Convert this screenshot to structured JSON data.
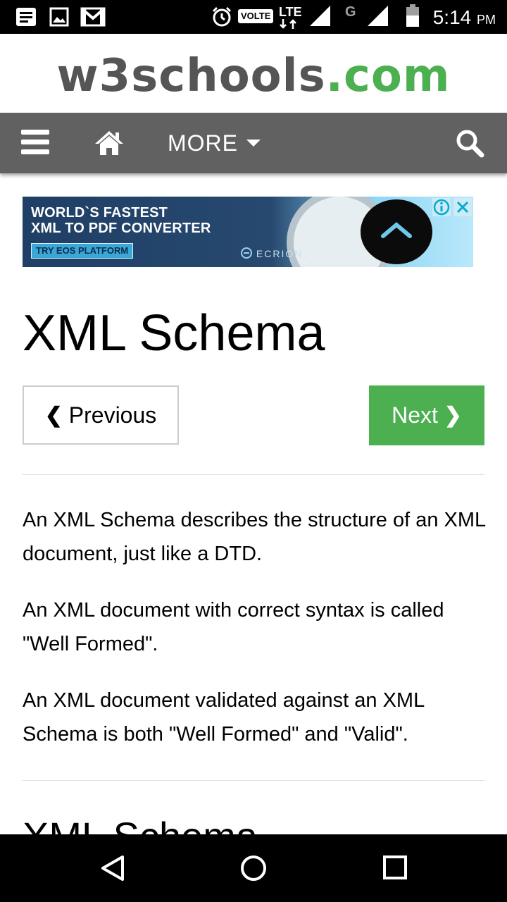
{
  "status_bar": {
    "left_icons": [
      "notification-icon",
      "gallery-icon",
      "gmail-icon"
    ],
    "right_icons": [
      "alarm-icon",
      "signal-icon",
      "signal-icon-2",
      "battery-icon"
    ],
    "volte": "VOLTE",
    "lte": "LTE",
    "network_g": "G",
    "time": "5:14",
    "ampm": "PM"
  },
  "header": {
    "logo_main": "w3schools",
    "logo_tld": ".com",
    "colors": {
      "logo_gray": "#555555",
      "logo_green": "#4CAF50"
    }
  },
  "nav": {
    "menu_icon": "hamburger-icon",
    "home_icon": "home-icon",
    "more_label": "MORE",
    "search_icon": "search-icon",
    "background": "#616161"
  },
  "ad": {
    "line1": "WORLD`S FASTEST",
    "line2": "XML TO PDF CONVERTER",
    "cta": "TRY EOS PLATFORM",
    "brand": "ECRION.",
    "info_icon": "info-icon",
    "close_icon": "close-icon"
  },
  "page": {
    "title": "XML Schema",
    "prev_chevron": "❮",
    "prev_label": "Previous",
    "next_label": "Next",
    "next_chevron": "❯",
    "paragraphs": [
      "An XML Schema describes the structure of an XML document, just like a DTD.",
      "An XML document with correct syntax is called \"Well Formed\".",
      "An XML document validated against an XML Schema is both \"Well Formed\" and \"Valid\"."
    ],
    "next_section_heading": "XML Schema",
    "accent": "#4CAF50"
  },
  "system_nav": {
    "back_icon": "back-icon",
    "home_icon": "home-circle-icon",
    "recents_icon": "recents-icon"
  }
}
